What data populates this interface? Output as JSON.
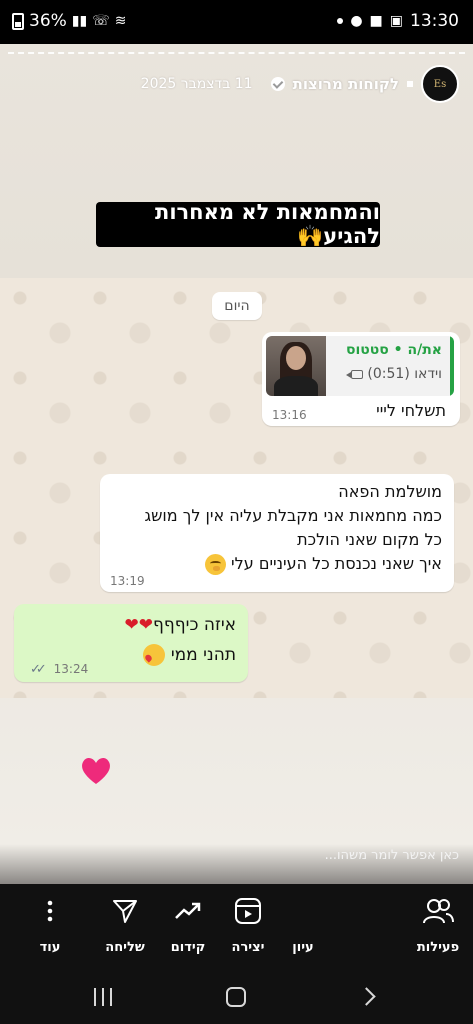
{
  "status_bar": {
    "battery": "36%",
    "time": "13:30"
  },
  "story": {
    "author_name": "לקוחות מרוצות",
    "date": "11 בדצמבר 2025",
    "avatar_text": "Es",
    "caption": "והמחמאות לא מאחרות להגיע🙌",
    "reply_placeholder": "כאן אפשר לומר משהו..."
  },
  "chat": {
    "day_label": "היום",
    "messages": [
      {
        "quote_name": "את/ה • סטטוס",
        "quote_sub": "וידאו (0:51)",
        "text": "תשלחי לייי",
        "time": "13:16"
      },
      {
        "lines": [
          "מושלמת הפאה",
          "כמה מחמאות אני מקבלת עליה אין לך מושג",
          "כל מקום שאני הולכת",
          "איך שאני נכנסת כל העיניים עלי"
        ],
        "time": "13:19"
      },
      {
        "lines": [
          "איזה כיףףף",
          "תהני ממי"
        ],
        "time": "13:24"
      }
    ]
  },
  "actions": [
    {
      "label": "פעילות",
      "icon": "people-icon"
    },
    {
      "label": "עיון",
      "icon": "eye-icon"
    },
    {
      "label": "יצירה",
      "icon": "reels-icon"
    },
    {
      "label": "קידום",
      "icon": "trend-icon"
    },
    {
      "label": "שליחה",
      "icon": "send-icon"
    },
    {
      "label": "עוד",
      "icon": "more-icon"
    }
  ],
  "colors": {
    "sent_bubble": "#dcf8c6",
    "quote_accent": "#25a244",
    "caption_bg": "#000000"
  }
}
